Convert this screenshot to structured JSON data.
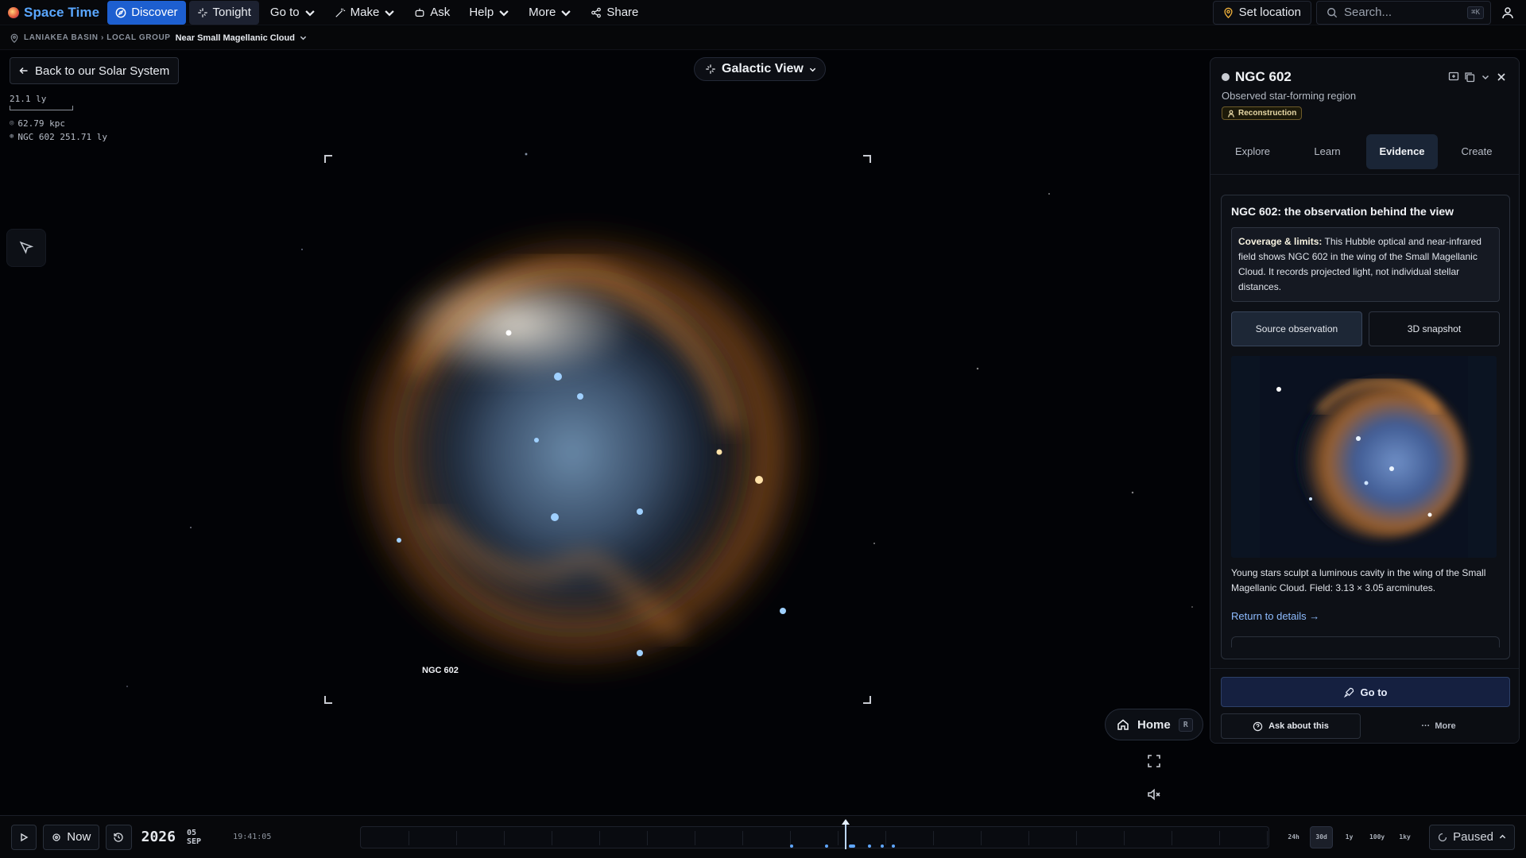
{
  "app": {
    "title": "Space Time"
  },
  "nav": {
    "discover": "Discover",
    "tonight": "Tonight",
    "goto": "Go to",
    "make": "Make",
    "ask": "Ask",
    "help": "Help",
    "more": "More",
    "share": "Share"
  },
  "top_right": {
    "set_location": "Set location",
    "search_placeholder": "Search...",
    "search_shortcut": "⌘K"
  },
  "breadcrumb": {
    "path": "LANIAKEA BASIN › LOCAL GROUP",
    "current": "Near Small Magellanic Cloud"
  },
  "viewport": {
    "back_label": "Back to our Solar System",
    "scale_label": "21.1 ly",
    "distance_row_1": "62.79 kpc",
    "distance_row_2": "NGC 602 251.71 ly",
    "view_mode": "Galactic View",
    "object_label": "NGC 602",
    "home_label": "Home",
    "home_shortcut": "R"
  },
  "panel": {
    "title": "NGC 602",
    "subtitle": "Observed star-forming region",
    "badge": "Reconstruction",
    "tabs": [
      "Explore",
      "Learn",
      "Evidence",
      "Create"
    ],
    "active_tab": "Evidence",
    "card_title": "NGC 602: the observation behind the view",
    "coverage_label": "Coverage & limits:",
    "coverage_text": "This Hubble optical and near-infrared field shows NGC 602 in the wing of the Small Magellanic Cloud. It records projected light, not individual stellar distances.",
    "source_btn": "Source observation",
    "snapshot_btn": "3D snapshot",
    "caption": "Young stars sculpt a luminous cavity in the wing of the Small Magellanic Cloud. Field: 3.13 × 3.05 arcminutes.",
    "return_link": "Return to details →",
    "goto_btn": "Go to",
    "ask_btn": "Ask about this",
    "more_btn": "More"
  },
  "timebar": {
    "now_label": "Now",
    "year": "2026",
    "date": "05 SEP",
    "time": "19:41:05",
    "ranges": [
      "24h",
      "30d",
      "1y",
      "100y",
      "1ky"
    ],
    "active_range": "30d",
    "state": "Paused"
  },
  "colors": {
    "accent": "#1d5fd0",
    "brand": "#5aa7ff",
    "link": "#8ebcff",
    "badge_border": "#6e5b2a"
  }
}
